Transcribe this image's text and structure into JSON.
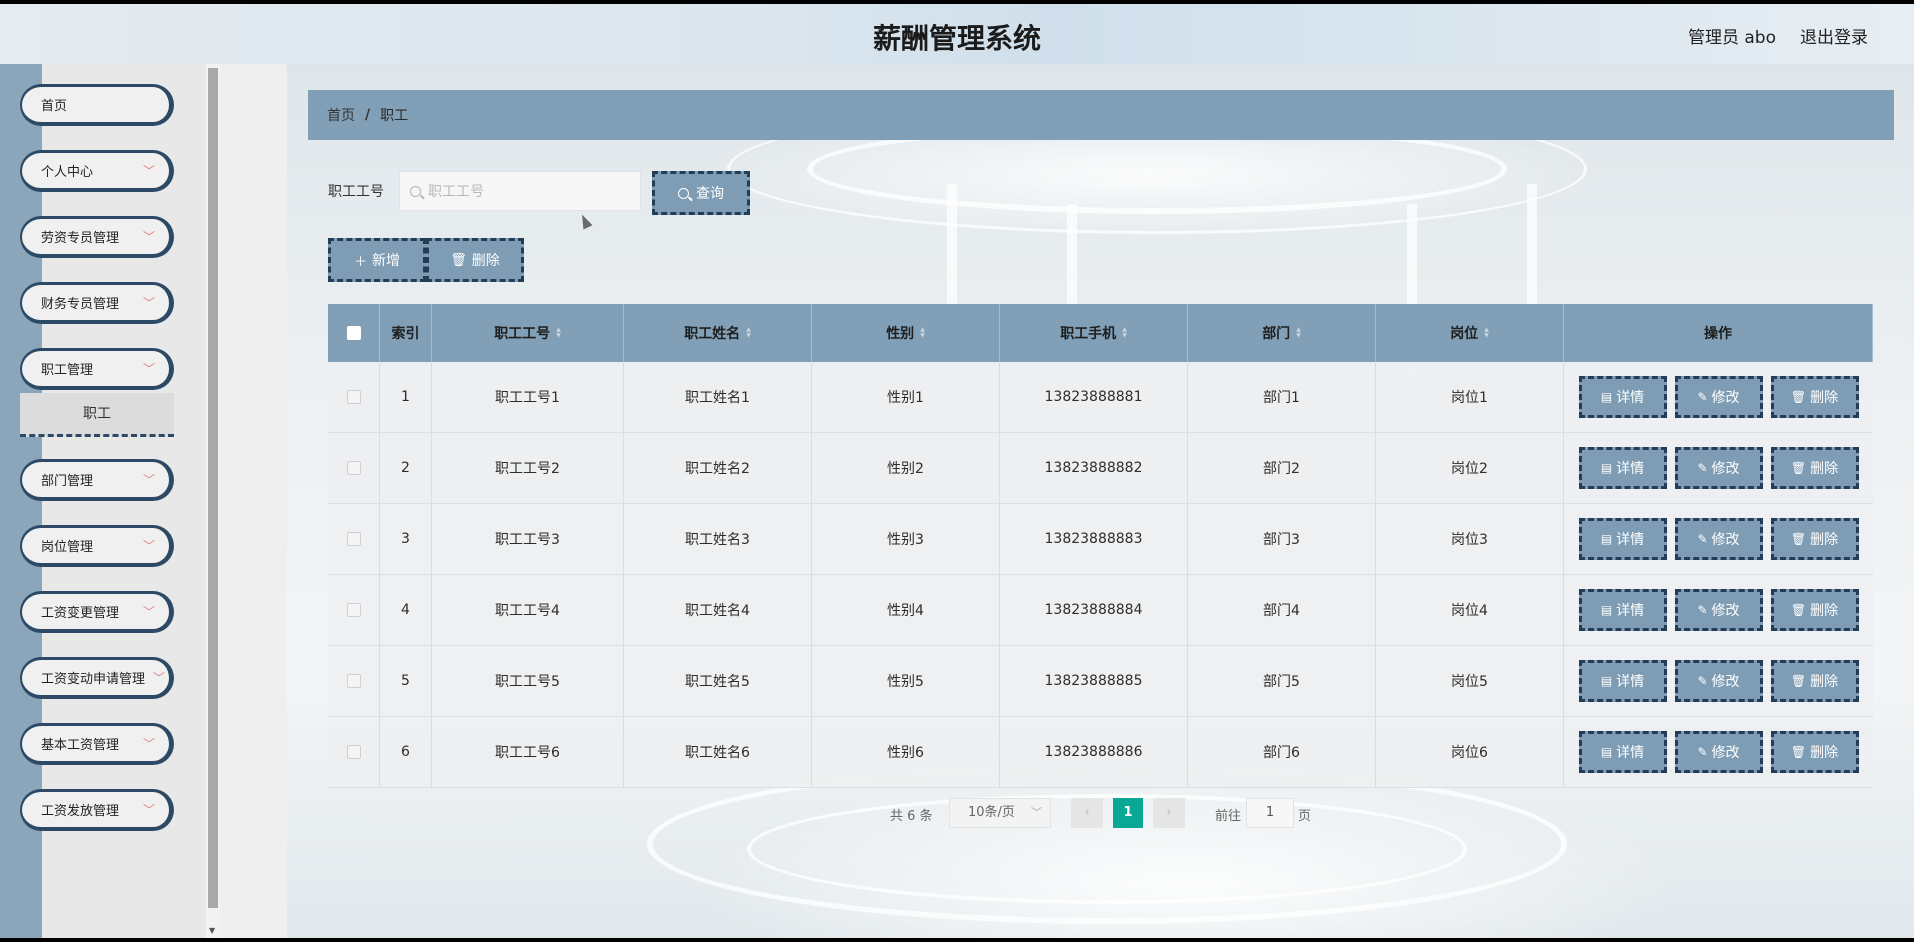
{
  "header": {
    "title": "薪酬管理系统",
    "user": "管理员 abo",
    "logout": "退出登录"
  },
  "sidebar": {
    "items": [
      {
        "label": "首页"
      },
      {
        "label": "个人中心"
      },
      {
        "label": "劳资专员管理"
      },
      {
        "label": "财务专员管理"
      },
      {
        "label": "职工管理"
      },
      {
        "label": "部门管理"
      },
      {
        "label": "岗位管理"
      },
      {
        "label": "工资变更管理"
      },
      {
        "label": "工资变动申请管理"
      },
      {
        "label": "基本工资管理"
      },
      {
        "label": "工资发放管理"
      }
    ],
    "sub_item": "职工",
    "chevron": "chevron-down-icon"
  },
  "breadcrumb": {
    "home": "首页",
    "separator": "/",
    "current": "职工"
  },
  "search": {
    "label": "职工工号",
    "placeholder": "职工工号",
    "button": "查询"
  },
  "actions": {
    "add": "新增",
    "delete": "删除"
  },
  "table": {
    "headers": [
      "",
      "索引",
      "职工工号",
      "职工姓名",
      "性别",
      "职工手机",
      "部门",
      "岗位",
      "操作"
    ],
    "rows": [
      {
        "index": "1",
        "no": "职工工号1",
        "name": "职工姓名1",
        "gender": "性别1",
        "phone": "13823888881",
        "dept": "部门1",
        "post": "岗位1"
      },
      {
        "index": "2",
        "no": "职工工号2",
        "name": "职工姓名2",
        "gender": "性别2",
        "phone": "13823888882",
        "dept": "部门2",
        "post": "岗位2"
      },
      {
        "index": "3",
        "no": "职工工号3",
        "name": "职工姓名3",
        "gender": "性别3",
        "phone": "13823888883",
        "dept": "部门3",
        "post": "岗位3"
      },
      {
        "index": "4",
        "no": "职工工号4",
        "name": "职工姓名4",
        "gender": "性别4",
        "phone": "13823888884",
        "dept": "部门4",
        "post": "岗位4"
      },
      {
        "index": "5",
        "no": "职工工号5",
        "name": "职工姓名5",
        "gender": "性别5",
        "phone": "13823888885",
        "dept": "部门5",
        "post": "岗位5"
      },
      {
        "index": "6",
        "no": "职工工号6",
        "name": "职工姓名6",
        "gender": "性别6",
        "phone": "13823888886",
        "dept": "部门6",
        "post": "岗位6"
      }
    ],
    "ops": {
      "detail": "详情",
      "edit": "修改",
      "delete": "删除"
    }
  },
  "pagination": {
    "total": "共 6 条",
    "page_size": "10条/页",
    "current_page": "1",
    "goto_label": "前往",
    "goto_value": "1",
    "unit": "页"
  },
  "colors": {
    "accent": "#81a0b7",
    "button_border": "#243d56",
    "page_active": "#0aa894",
    "sidebar_strip": "#8ba6bb"
  }
}
